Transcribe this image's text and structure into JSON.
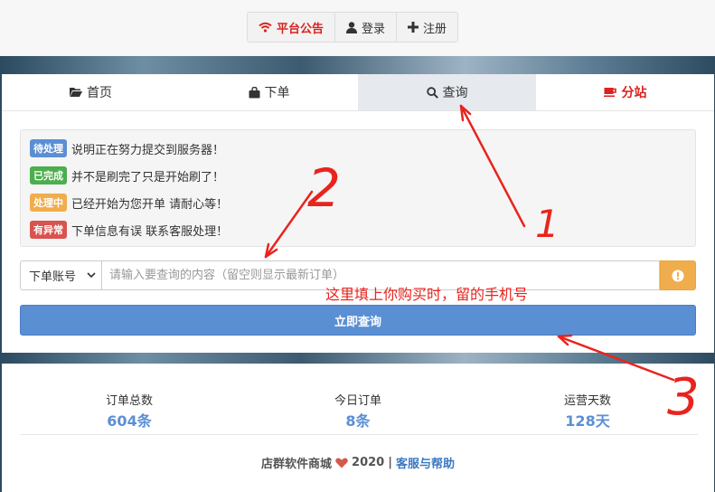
{
  "top_nav": {
    "announcement": "平台公告",
    "login": "登录",
    "register": "注册"
  },
  "tabs": [
    {
      "label": "首页",
      "icon": "folder-open-icon"
    },
    {
      "label": "下单",
      "icon": "shopping-bag-icon"
    },
    {
      "label": "查询",
      "icon": "search-icon",
      "active": true
    },
    {
      "label": "分站",
      "icon": "coffee-cup-icon"
    }
  ],
  "status_items": [
    {
      "badge": "待处理",
      "text": "说明正在努力提交到服务器！",
      "color": "#5b8fd4"
    },
    {
      "badge": "已完成",
      "text": "并不是刷完了只是开始刷了！",
      "color": "#4cae4c"
    },
    {
      "badge": "处理中",
      "text": "已经开始为您开单 请耐心等！",
      "color": "#f0ad4e"
    },
    {
      "badge": "有异常",
      "text": "下单信息有误 联系客服处理！",
      "color": "#d9534f"
    }
  ],
  "query": {
    "select_value": "下单账号",
    "placeholder": "请输入要查询的内容（留空则显示最新订单）",
    "submit_label": "立即查询"
  },
  "stats": [
    {
      "label": "订单总数",
      "value": "604条"
    },
    {
      "label": "今日订单",
      "value": "8条"
    },
    {
      "label": "运营天数",
      "value": "128天"
    }
  ],
  "footer": {
    "brand": "店群软件商城",
    "year": "2020",
    "separator": "|",
    "help_link": "客服与帮助"
  },
  "annotations": {
    "note": "这里填上你购买时，留的手机号",
    "marker_1": "1",
    "marker_2": "2",
    "marker_3": "3",
    "ink_color": "#e8241e"
  }
}
